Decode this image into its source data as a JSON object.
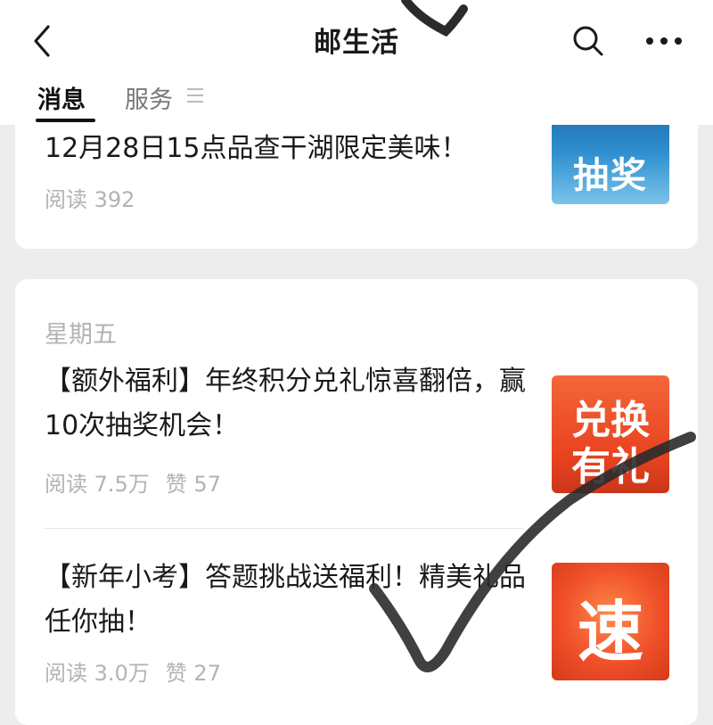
{
  "header": {
    "title": "邮生活",
    "back_icon": "chevron-left-icon",
    "search_icon": "search-icon",
    "more_icon": "more-horizontal-icon"
  },
  "tabs": [
    {
      "label": "消息",
      "active": true
    },
    {
      "label": "服务",
      "active": false
    }
  ],
  "articles": [
    {
      "title": "12月28日15点品查干湖限定美味！",
      "reads": "阅读 392",
      "likes": "",
      "thumb_text": "抽奖",
      "thumb_color": "#2a7fbf"
    },
    {
      "title": "【额外福利】年终积分兑礼惊喜翻倍，赢10次抽奖机会！",
      "reads": "阅读 7.5万",
      "likes": "赞 57",
      "thumb_text_line1": "兑换",
      "thumb_text_line2": "有礼",
      "thumb_color": "#f0502a"
    },
    {
      "title": "【新年小考】答题挑战送福利！精美礼品任你抽！",
      "reads": "阅读 3.0万",
      "likes": "赞 27",
      "thumb_text": "速",
      "thumb_color": "#f0502a"
    }
  ],
  "day_label": "星期五"
}
